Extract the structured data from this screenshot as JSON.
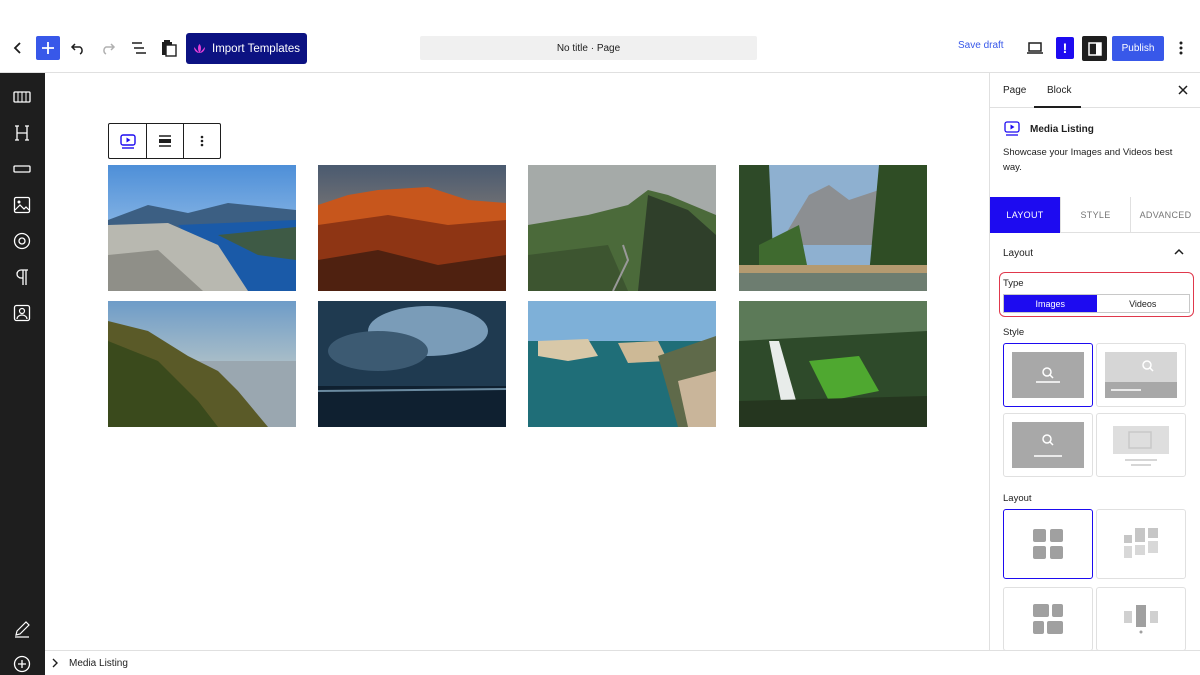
{
  "topbar": {
    "import_label": "Import Templates",
    "document_title": "No title · Page",
    "save_draft": "Save draft",
    "notice_label": "!",
    "publish_label": "Publish"
  },
  "rail": {
    "icons": [
      "slider-icon",
      "heading-icon",
      "button-block-icon",
      "image-icon",
      "target-icon",
      "paragraph-icon",
      "portrait-icon",
      "pencil-icon",
      "add-circle-icon"
    ]
  },
  "canvas": {
    "block_toolbar": [
      "media-listing-icon",
      "align-icon",
      "more-options-icon"
    ],
    "photos": [
      "fjord",
      "red-canyon",
      "green-cliffs",
      "yosemite-valley",
      "coastal-cliffs",
      "stormy-sea",
      "turquoise-coast",
      "waterfall"
    ]
  },
  "footer": {
    "breadcrumb": "Media Listing"
  },
  "panel": {
    "tabs": [
      "Page",
      "Block"
    ],
    "active_tab": "Block",
    "block_name": "Media Listing",
    "block_description": "Showcase your Images and Videos best way.",
    "sub_tabs": [
      "LAYOUT",
      "STYLE",
      "ADVANCED"
    ],
    "active_sub_tab": "LAYOUT",
    "section_title": "Layout",
    "type_label": "Type",
    "type_options": [
      "Images",
      "Videos"
    ],
    "type_selected": "Images",
    "style_label": "Style",
    "layout_label": "Layout"
  },
  "colors": {
    "wp_blue": "#3858e9",
    "import_bg": "#0c1282",
    "active_blue": "#1d0bf0",
    "highlight_red": "#e0384c",
    "rail_bg": "#1e1e1e"
  }
}
